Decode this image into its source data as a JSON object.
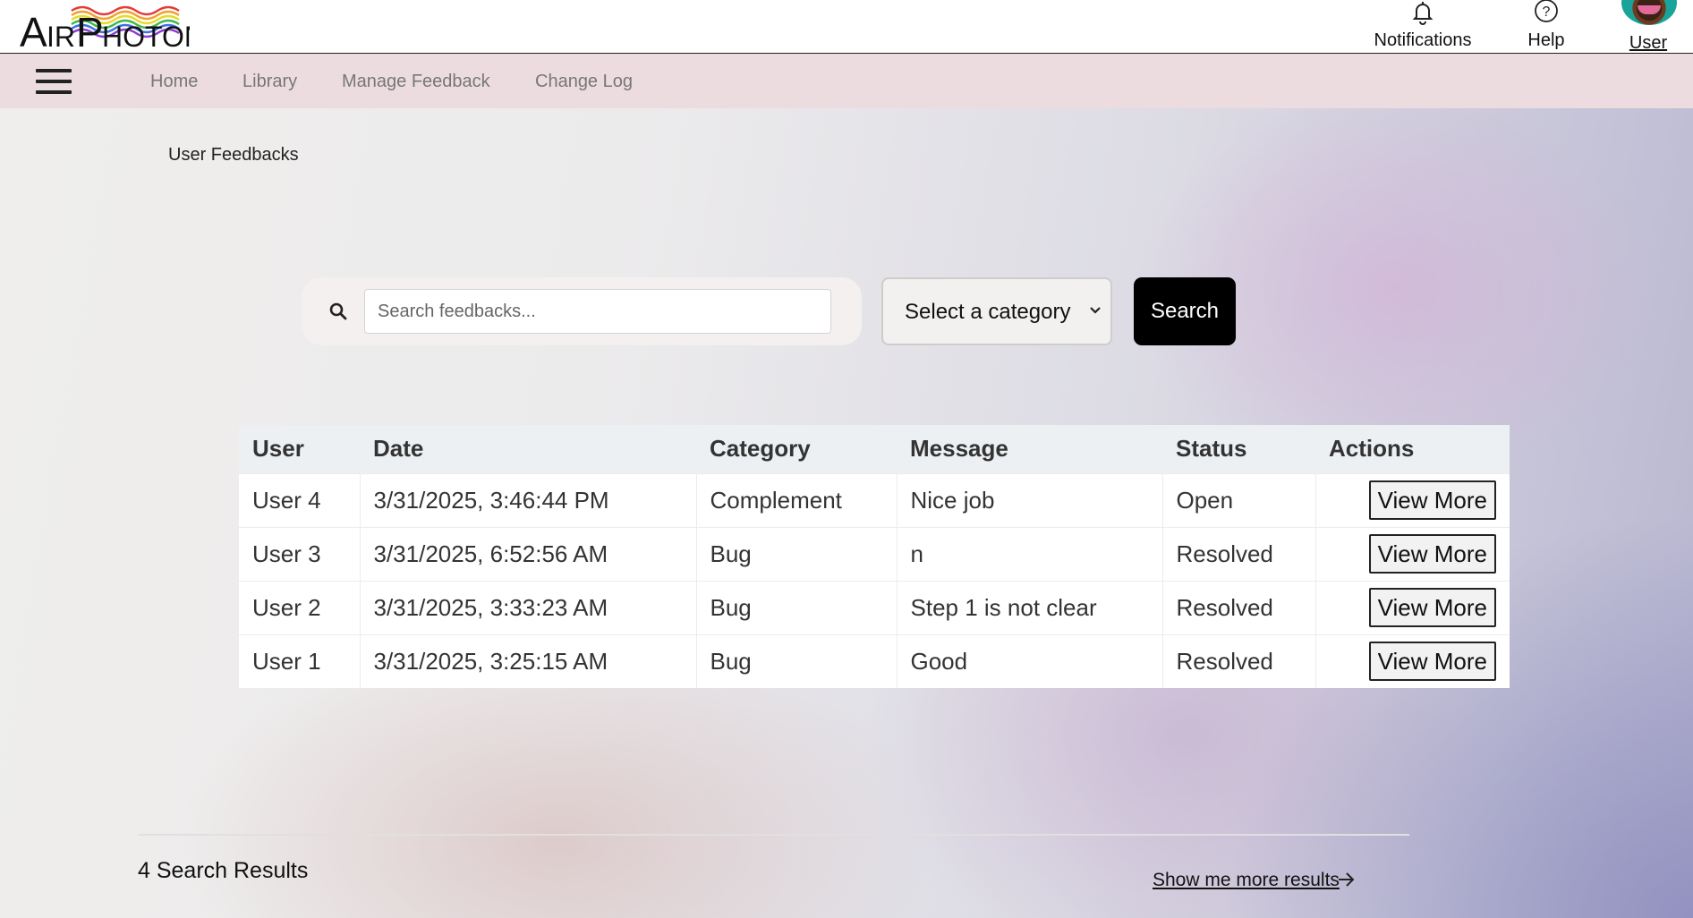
{
  "header": {
    "logo_text": "AIRPHOTON",
    "notifications_label": "Notifications",
    "help_label": "Help",
    "user_label": "User"
  },
  "nav": {
    "items": [
      "Home",
      "Library",
      "Manage Feedback",
      "Change Log"
    ]
  },
  "page": {
    "title": "User Feedbacks"
  },
  "search": {
    "placeholder": "Search feedbacks...",
    "value": "",
    "category_selected": "Select a category",
    "button_label": "Search"
  },
  "table": {
    "columns": [
      "User",
      "Date",
      "Category",
      "Message",
      "Status",
      "Actions"
    ],
    "rows": [
      {
        "user": "User 4",
        "date": "3/31/2025, 3:46:44 PM",
        "category": "Complement",
        "message": "Nice job",
        "status": "Open",
        "action": "View More"
      },
      {
        "user": "User 3",
        "date": "3/31/2025, 6:52:56 AM",
        "category": "Bug",
        "message": "n",
        "status": "Resolved",
        "action": "View More"
      },
      {
        "user": "User 2",
        "date": "3/31/2025, 3:33:23 AM",
        "category": "Bug",
        "message": "Step 1 is not clear",
        "status": "Resolved",
        "action": "View More"
      },
      {
        "user": "User 1",
        "date": "3/31/2025, 3:25:15 AM",
        "category": "Bug",
        "message": "Good",
        "status": "Resolved",
        "action": "View More"
      }
    ]
  },
  "footer": {
    "result_count": "4 Search Results",
    "more_link": "Show me more results"
  },
  "icons": {
    "bell": "bell-icon",
    "help": "help-circle-icon",
    "search": "search-icon",
    "chevron": "chevron-down-icon",
    "arrow": "arrow-right-icon",
    "menu": "hamburger-icon"
  },
  "colors": {
    "nav_background": "#ecdcdf",
    "search_button": "#000000",
    "table_header": "#edf0f3"
  }
}
